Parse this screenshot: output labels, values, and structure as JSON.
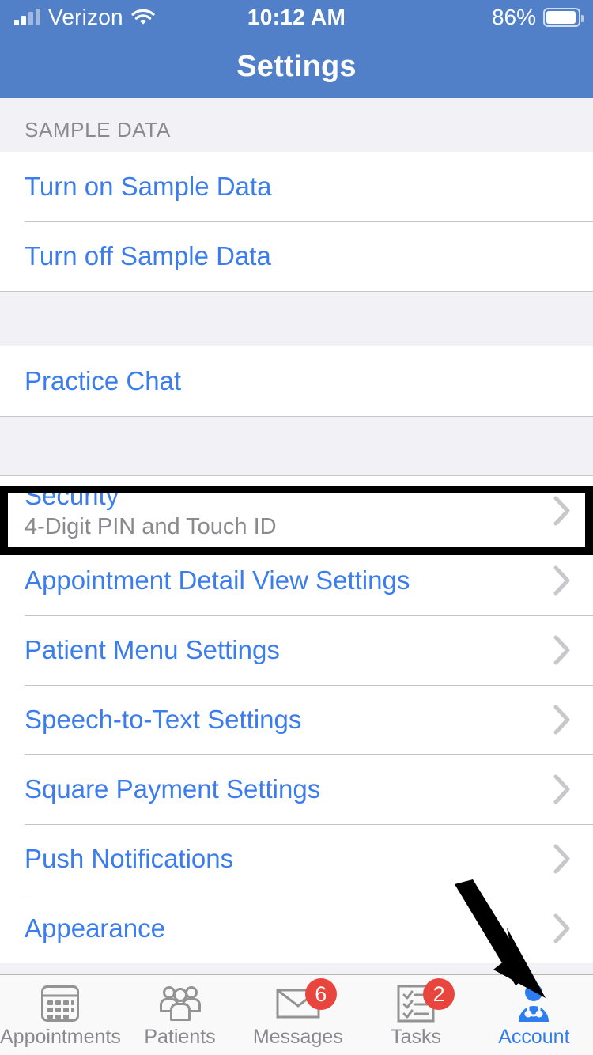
{
  "status_bar": {
    "carrier": "Verizon",
    "signal_icon": "signal-bars-icon",
    "wifi_icon": "wifi-icon",
    "time": "10:12 AM",
    "battery_percent": "86%",
    "battery_icon": "battery-icon"
  },
  "nav": {
    "title": "Settings"
  },
  "colors": {
    "navbar_blue": "#5180C8",
    "link_blue": "#3B7DEC",
    "accent_blue": "#2E7DF0",
    "badge_red": "#E8453C",
    "group_background": "#F2F2F6",
    "separator": "#C6C6C8",
    "secondary_text": "#8A8A8E",
    "highlight_outline": "#000000"
  },
  "sections": [
    {
      "header": "SAMPLE DATA",
      "rows": [
        {
          "label": "Turn on Sample Data",
          "sub": "",
          "chevron": false,
          "highlighted": false
        },
        {
          "label": "Turn off Sample Data",
          "sub": "",
          "chevron": false,
          "highlighted": false
        }
      ]
    },
    {
      "header": "",
      "rows": [
        {
          "label": "Practice Chat",
          "sub": "",
          "chevron": false,
          "highlighted": false
        }
      ]
    },
    {
      "header": "",
      "rows": [
        {
          "label": "Security",
          "sub": "4-Digit PIN and Touch ID",
          "chevron": true,
          "highlighted": true
        },
        {
          "label": "Appointment Detail View Settings",
          "sub": "",
          "chevron": true,
          "highlighted": false
        },
        {
          "label": "Patient Menu Settings",
          "sub": "",
          "chevron": true,
          "highlighted": false
        },
        {
          "label": "Speech-to-Text Settings",
          "sub": "",
          "chevron": true,
          "highlighted": false
        },
        {
          "label": "Square Payment Settings",
          "sub": "",
          "chevron": true,
          "highlighted": false
        },
        {
          "label": "Push Notifications",
          "sub": "",
          "chevron": true,
          "highlighted": false
        },
        {
          "label": "Appearance",
          "sub": "",
          "chevron": true,
          "highlighted": false
        }
      ]
    }
  ],
  "tabbar": {
    "items": [
      {
        "label": "Appointments",
        "icon": "calendar-icon",
        "badge": "",
        "active": false
      },
      {
        "label": "Patients",
        "icon": "people-group-icon",
        "badge": "",
        "active": false
      },
      {
        "label": "Messages",
        "icon": "envelope-icon",
        "badge": "6",
        "active": false
      },
      {
        "label": "Tasks",
        "icon": "checklist-icon",
        "badge": "2",
        "active": false
      },
      {
        "label": "Account",
        "icon": "doctor-avatar-icon",
        "badge": "",
        "active": true
      }
    ]
  },
  "annotation": {
    "arrow_icon": "pointer-arrow-icon",
    "arrow_points_to": "Account"
  }
}
